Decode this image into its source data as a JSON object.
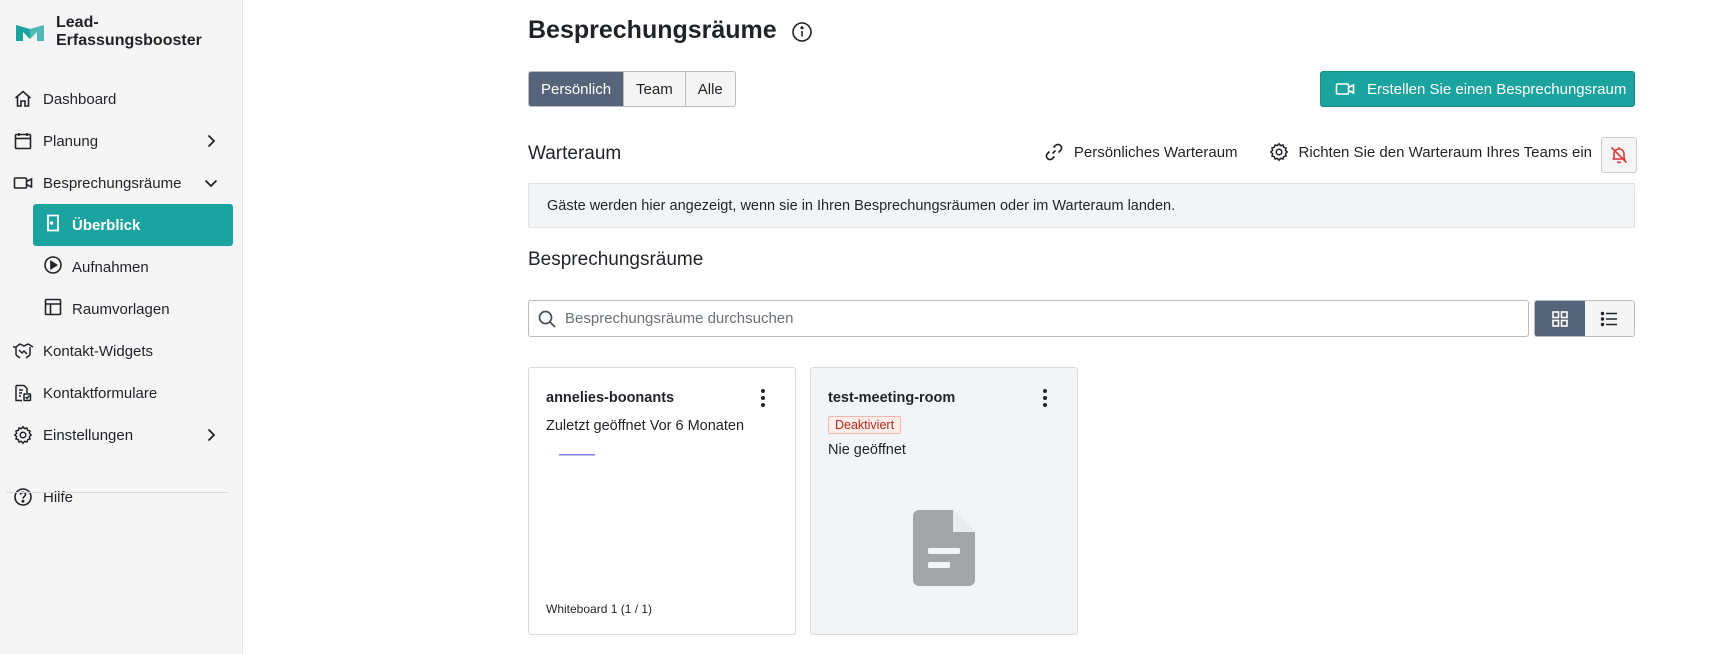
{
  "app": {
    "name_line1": "Lead-",
    "name_line2": "Erfassungsbooster",
    "brand_color": "#1aa39f"
  },
  "sidebar": {
    "items": [
      {
        "label": "Dashboard",
        "icon": "home-icon"
      },
      {
        "label": "Planung",
        "icon": "calendar-icon"
      },
      {
        "label": "Besprechungsräume",
        "icon": "video-icon"
      },
      {
        "label": "Überblick",
        "icon": "door-icon"
      },
      {
        "label": "Aufnahmen",
        "icon": "play-circle-icon"
      },
      {
        "label": "Raumvorlagen",
        "icon": "layout-icon"
      },
      {
        "label": "Kontakt-Widgets",
        "icon": "handshake-icon"
      },
      {
        "label": "Kontaktformulare",
        "icon": "form-icon"
      },
      {
        "label": "Einstellungen",
        "icon": "gear-icon"
      },
      {
        "label": "Hilfe",
        "icon": "help-icon"
      }
    ]
  },
  "main": {
    "title": "Besprechungsräume",
    "filters": {
      "personal": "Persönlich",
      "team": "Team",
      "all": "Alle",
      "selected": "Persönlich"
    },
    "create_button": "Erstellen Sie einen Besprechungsraum",
    "waiting_room": {
      "title": "Warteraum",
      "personal_link": "Persönliches Warteraum",
      "team_setup": "Richten Sie den Warteraum Ihres Teams ein",
      "info": "Gäste werden hier angezeigt, wenn sie in Ihren Besprechungsräumen oder im Warteraum landen."
    },
    "rooms_section_title": "Besprechungsräume",
    "search_placeholder": "Besprechungsräume durchsuchen",
    "view_mode": "grid",
    "rooms": [
      {
        "name": "annelies-boonants",
        "last_opened": "Zuletzt geöffnet Vor 6 Monaten",
        "footer": "Whiteboard 1 (1 / 1)"
      },
      {
        "name": "test-meeting-room",
        "status": "Deaktiviert",
        "last_opened": "Nie geöffnet"
      }
    ]
  }
}
